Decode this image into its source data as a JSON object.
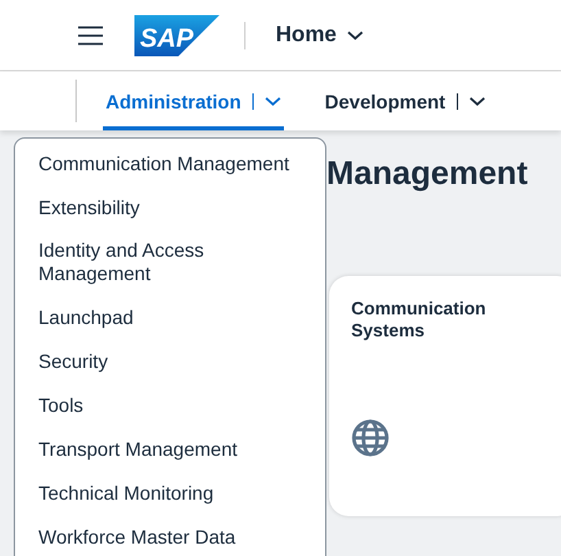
{
  "header": {
    "logo": "SAP",
    "title": "Home"
  },
  "tabs": [
    {
      "label": "Administration",
      "selected": true
    },
    {
      "label": "Development",
      "selected": false
    }
  ],
  "page": {
    "heading": "Management"
  },
  "menu": {
    "items": [
      "Communication Management",
      "Extensibility",
      "Identity and Access Management",
      "Launchpad",
      "Security",
      "Tools",
      "Transport Management",
      "Technical Monitoring",
      "Workforce Master Data"
    ]
  },
  "tiles": [
    {
      "title": "Communication Systems"
    }
  ]
}
